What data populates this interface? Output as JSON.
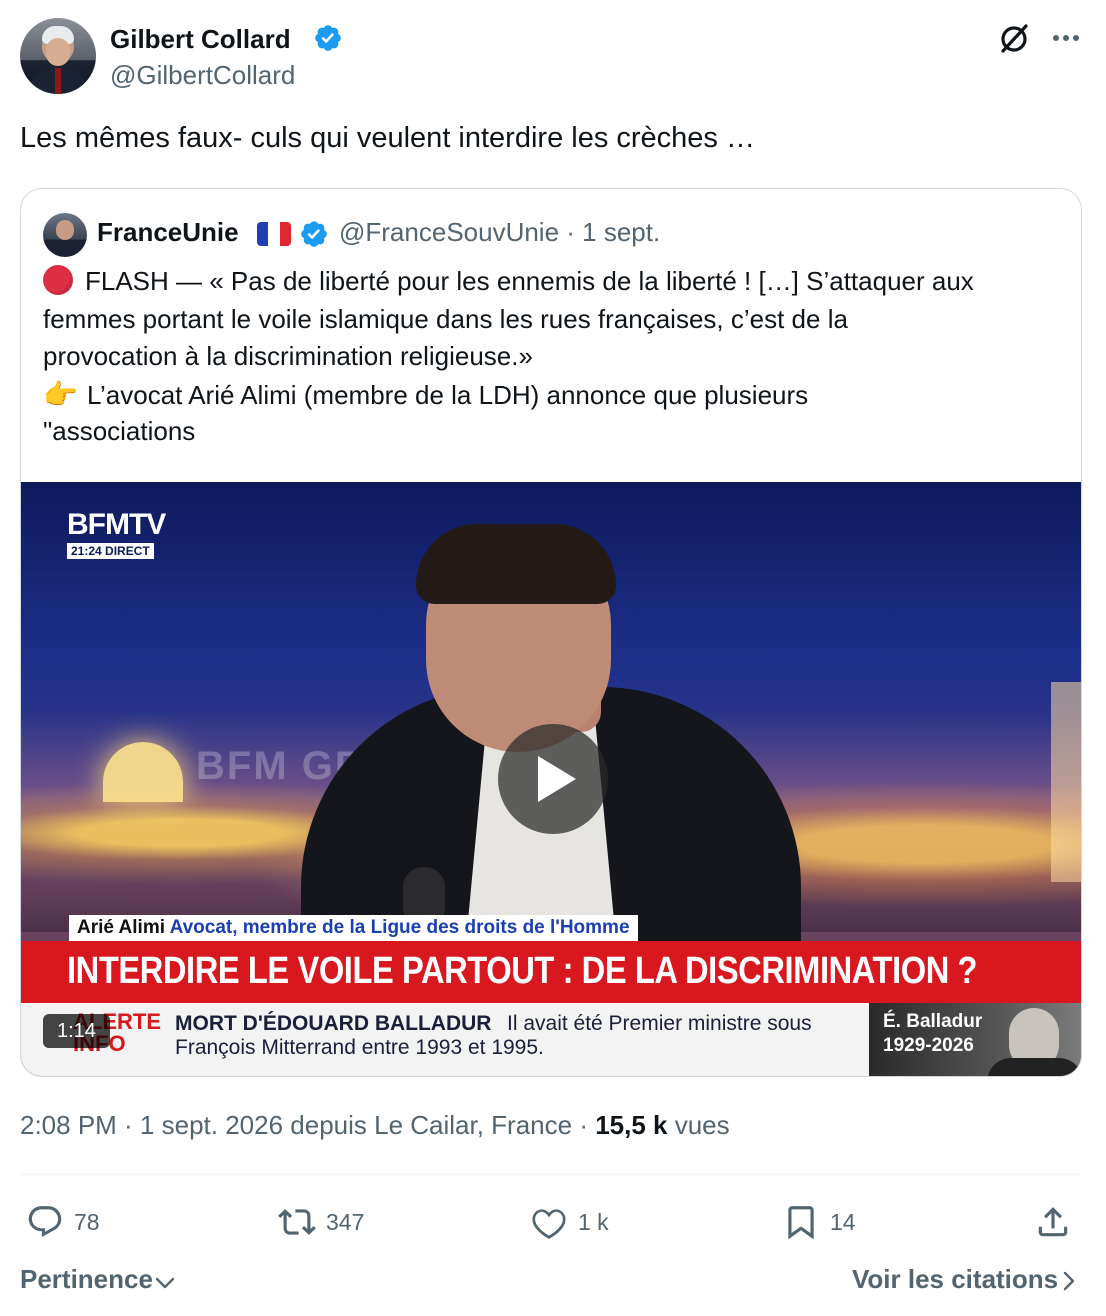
{
  "tweet": {
    "author_name": "Gilbert Collard",
    "author_handle": "@GilbertCollard",
    "text": "Les mêmes faux- culs qui veulent interdire les crèches …",
    "timestamp": "2:08 PM · 1 sept. 2026 depuis Le Cailar, France · ",
    "views_count": "15,5 k",
    "views_label": " vues"
  },
  "quoted": {
    "name": "FranceUnie",
    "handle_date": "@FranceSouvUnie · 1 sept.",
    "lines": [
      "FLASH — « Pas de liberté pour les ennemis de la liberté ! […] S’attaquer aux",
      "femmes portant le voile islamique dans les rues françaises, c’est de la",
      "provocation à la discrimination religieuse.»",
      "L’avocat Arié Alimi (membre de la LDH) annonce que plusieurs",
      "\"associations"
    ],
    "hand_emoji": "👉"
  },
  "video": {
    "channel_logo": "BFMTV",
    "channel_tag": "21:24  DIRECT",
    "faded_text": "BFM GRA",
    "lower_third_name": "Arié Alimi",
    "lower_third_title": "Avocat, membre de la Ligue des droits de l'Homme",
    "banner": "INTERDIRE LE VOILE PARTOUT : DE LA DISCRIMINATION ?",
    "alert_line1": "ALERTE",
    "alert_line2": "INFO",
    "ticker_bold": "MORT D'ÉDOUARD BALLADUR",
    "ticker_rest": "Il avait été Premier ministre sous",
    "ticker_line2": "François Mitterrand entre 1993 et 1995.",
    "portrait_name": "É. Balladur",
    "portrait_years": "1929-2026",
    "duration": "1:14"
  },
  "actions": {
    "replies": "78",
    "reposts": "347",
    "likes": "1 k",
    "bookmarks": "14"
  },
  "footer": {
    "sort_label": "Pertinence",
    "quotes_link": "Voir les citations"
  },
  "icons": {
    "verified": "verified-badge-icon",
    "grok": "grok-icon",
    "more": "more-icon",
    "reply": "reply-icon",
    "repost": "repost-icon",
    "like": "heart-icon",
    "bookmark": "bookmark-icon",
    "share": "share-icon",
    "play": "play-icon",
    "chevron_down": "chevron-down-icon",
    "chevron_right": "chevron-right-icon"
  },
  "colors": {
    "verified_blue": "#1d9bf0",
    "text_primary": "#0f1419",
    "text_secondary": "#536471",
    "banner_red": "#d8171e"
  }
}
